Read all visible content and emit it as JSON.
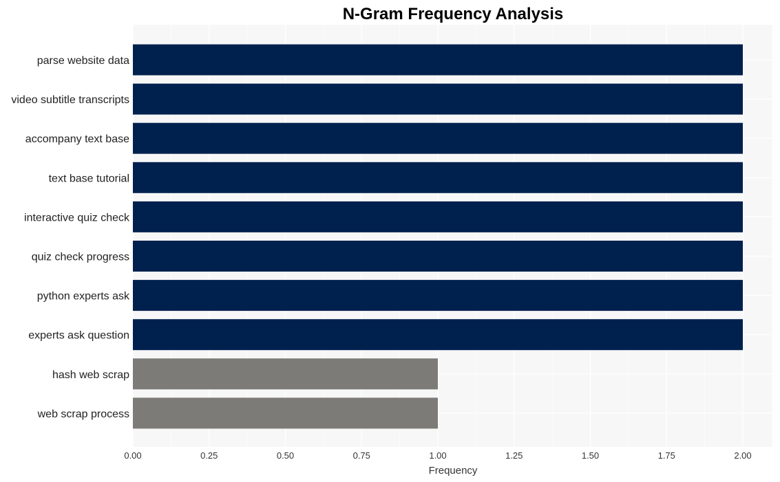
{
  "chart_data": {
    "type": "bar",
    "orientation": "horizontal",
    "title": "N-Gram Frequency Analysis",
    "xlabel": "Frequency",
    "ylabel": "",
    "xlim": [
      0,
      2.1
    ],
    "xticks": [
      "0.00",
      "0.25",
      "0.50",
      "0.75",
      "1.00",
      "1.25",
      "1.50",
      "1.75",
      "2.00"
    ],
    "grid": true,
    "legend": "none",
    "categories": [
      "parse website data",
      "video subtitle transcripts",
      "accompany text base",
      "text base tutorial",
      "interactive quiz check",
      "quiz check progress",
      "python experts ask",
      "experts ask question",
      "hash web scrap",
      "web scrap process"
    ],
    "values": [
      2,
      2,
      2,
      2,
      2,
      2,
      2,
      2,
      1,
      1
    ],
    "colors": {
      "high": "#00214e",
      "low": "#7c7b78",
      "plot_background": "#f7f7f7",
      "grid": "#ffffff"
    }
  }
}
